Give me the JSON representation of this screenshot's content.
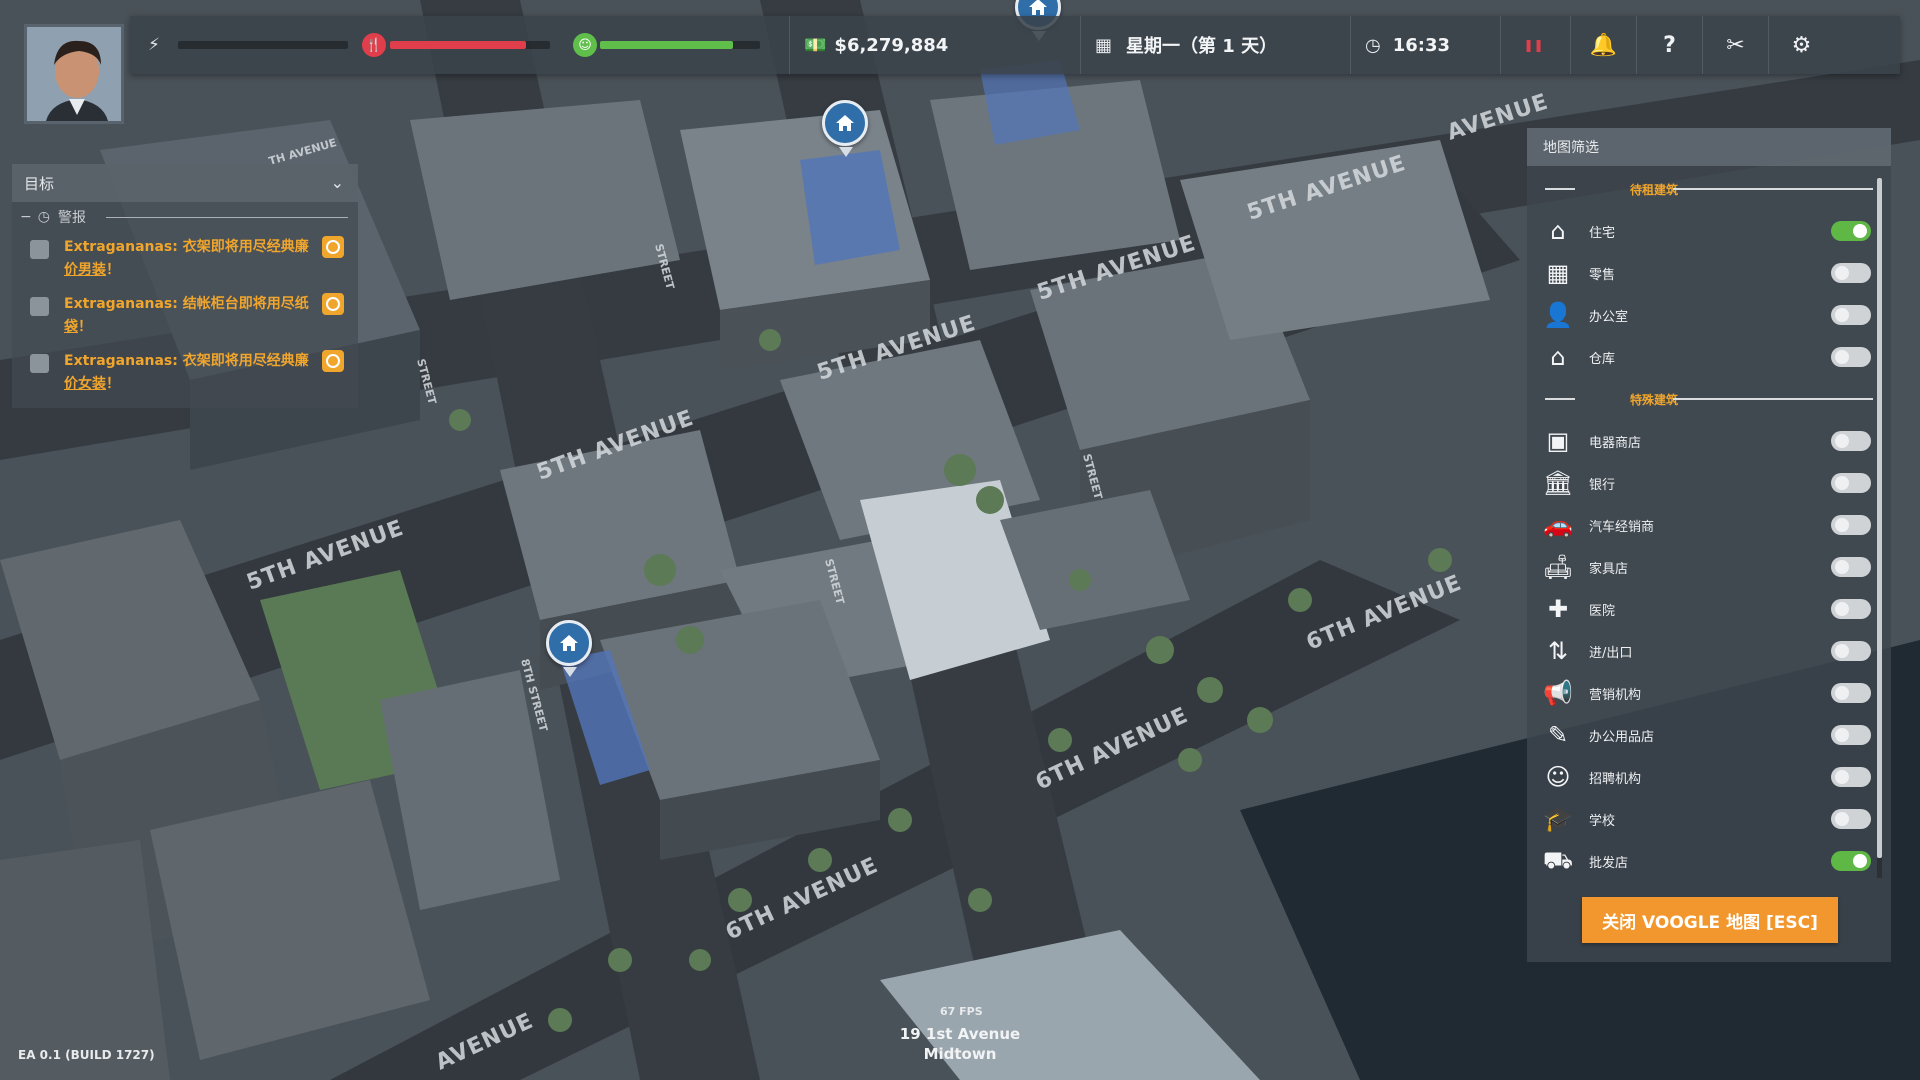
{
  "topbar": {
    "money": "$6,279,884",
    "date": "星期一（第 1 天）",
    "time": "16:33",
    "meters": [
      {
        "name": "energy",
        "icon": "lightning-icon",
        "level": 0.0,
        "color": "#9aa3ab"
      },
      {
        "name": "hunger",
        "icon": "fork-knife-icon",
        "level": 0.85,
        "color": "#e03e4a"
      },
      {
        "name": "happiness",
        "icon": "smiley-icon",
        "level": 0.83,
        "color": "#5fbf4a"
      }
    ],
    "buttons": [
      "bell-icon",
      "question-icon",
      "tools-icon",
      "gear-icon"
    ]
  },
  "objectives": {
    "title": "目标",
    "alerts_label": "警报",
    "items": [
      {
        "brand": "Extragananas: ",
        "text": "衣架即将用尽经典廉",
        "link": "价男装",
        "end": "！"
      },
      {
        "brand": "Extragananas: ",
        "text": "结帐柜台即将用尽纸",
        "link": "袋",
        "end": "！"
      },
      {
        "brand": "Extragananas: ",
        "text": "衣架即将用尽经典廉",
        "link": "价女装",
        "end": "！"
      }
    ]
  },
  "filter": {
    "title": "地图筛选",
    "rental_label": "待租建筑",
    "rental": [
      {
        "label": "住宅",
        "icon": "house-icon",
        "glyph": "⌂",
        "on": true
      },
      {
        "label": "零售",
        "icon": "shop-icon",
        "glyph": "▦",
        "on": false
      },
      {
        "label": "办公室",
        "icon": "office-worker-icon",
        "glyph": "👤",
        "on": false
      },
      {
        "label": "仓库",
        "icon": "warehouse-icon",
        "glyph": "⌂",
        "on": false
      }
    ],
    "special_label": "特殊建筑",
    "special": [
      {
        "label": "电器商店",
        "icon": "appliance-store-icon",
        "glyph": "▣",
        "on": false
      },
      {
        "label": "银行",
        "icon": "bank-icon",
        "glyph": "🏛",
        "on": false
      },
      {
        "label": "汽车经销商",
        "icon": "car-dealer-icon",
        "glyph": "🚗",
        "on": false
      },
      {
        "label": "家具店",
        "icon": "furniture-store-icon",
        "glyph": "🛋",
        "on": false
      },
      {
        "label": "医院",
        "icon": "hospital-icon",
        "glyph": "✚",
        "on": false
      },
      {
        "label": "进/出口",
        "icon": "import-export-icon",
        "glyph": "⇅",
        "on": false
      },
      {
        "label": "营销机构",
        "icon": "marketing-icon",
        "glyph": "📢",
        "on": false
      },
      {
        "label": "办公用品店",
        "icon": "office-supply-icon",
        "glyph": "✎",
        "on": false
      },
      {
        "label": "招聘机构",
        "icon": "recruitment-icon",
        "glyph": "☺",
        "on": false
      },
      {
        "label": "学校",
        "icon": "school-icon",
        "glyph": "🎓",
        "on": false
      },
      {
        "label": "批发店",
        "icon": "wholesale-icon",
        "glyph": "⛟",
        "on": true
      }
    ],
    "close_button": "关闭 VOOGLE 地图 [ESC]"
  },
  "map": {
    "streets": [
      "5TH AVENUE",
      "5TH AVENUE",
      "5TH AVENUE",
      "5TH AVENUE",
      "5TH AVENUE",
      "6TH AVENUE",
      "6TH AVENUE",
      "6TH AVENUE",
      "AVENUE",
      "AVENUE",
      "TH AVENUE",
      "STREET",
      "STREET",
      "STREET",
      "8TH STREET",
      "STREET"
    ],
    "fps": "67 FPS",
    "location_line1": "19 1st Avenue",
    "location_line2": "Midtown"
  },
  "build": "EA 0.1 (BUILD 1727)"
}
